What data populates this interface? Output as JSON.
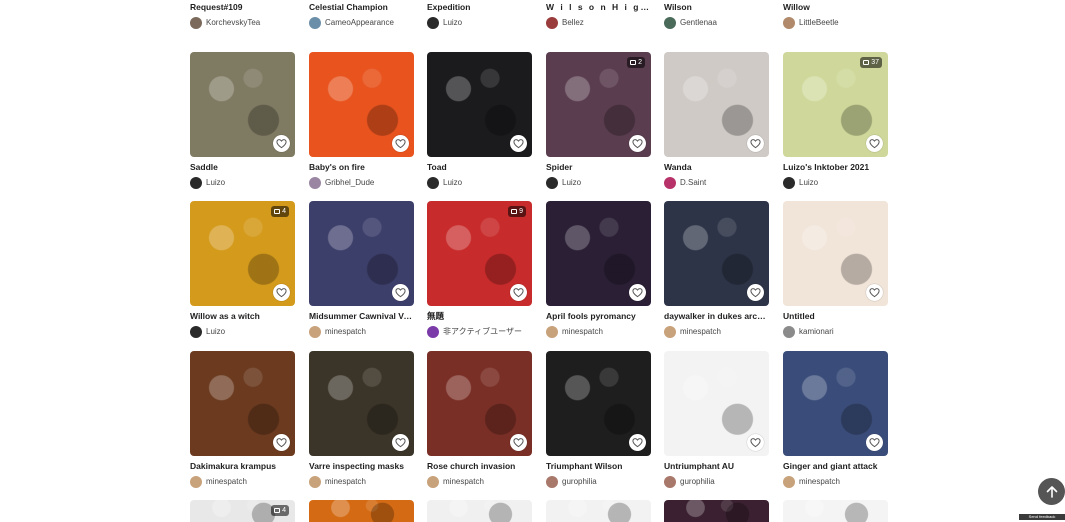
{
  "heart_icon": "heart-icon",
  "rows": [
    {
      "variant": "short",
      "cards": [
        {
          "title": "Request#109",
          "author": "KorchevskyTea",
          "color": "#d9d5cf",
          "avatar": "#7b6a5c"
        },
        {
          "title": "Celestial Champion",
          "author": "CameoAppearance",
          "color": "#2d4a8a",
          "avatar": "#6c8fa9"
        },
        {
          "title": "Expedition",
          "author": "Luizo",
          "color": "#3b3a3a",
          "avatar": "#2a2a2a"
        },
        {
          "title": "W i l s o n H i g g s b u r y",
          "author": "Bellez",
          "color": "#454545",
          "avatar": "#9b3c3c",
          "spaced": true
        },
        {
          "title": "Wilson",
          "author": "Gentlenaa",
          "color": "#e8c8a0",
          "avatar": "#4a6a5a"
        },
        {
          "title": "Willow",
          "author": "LittleBeetle",
          "color": "#b7562b",
          "avatar": "#b08a6a"
        }
      ]
    },
    {
      "cards": [
        {
          "title": "Saddle",
          "author": "Luizo",
          "color": "#7f7a62",
          "avatar": "#2a2a2a"
        },
        {
          "title": "Baby's on fire",
          "author": "Gribhel_Dude",
          "color": "#e8531e",
          "avatar": "#9a86a3"
        },
        {
          "title": "Toad",
          "author": "Luizo",
          "color": "#1b1b1e",
          "avatar": "#2a2a2a"
        },
        {
          "title": "Spider",
          "author": "Luizo",
          "color": "#5a3d4f",
          "avatar": "#2a2a2a",
          "badge": "2"
        },
        {
          "title": "Wanda",
          "author": "D.Saint",
          "color": "#cfcac6",
          "avatar": "#b8326a"
        },
        {
          "title": "Luizo's Inktober 2021",
          "author": "Luizo",
          "color": "#cfd89a",
          "avatar": "#2a2a2a",
          "badge": "37"
        }
      ]
    },
    {
      "cards": [
        {
          "title": "Willow as a witch",
          "author": "Luizo",
          "color": "#d49a1c",
          "avatar": "#2a2a2a",
          "badge": "4"
        },
        {
          "title": "Midsummer Cawnival Velka",
          "author": "minespatch",
          "color": "#3d3f6b",
          "avatar": "#c8a27a"
        },
        {
          "title": "無題",
          "author": "非アクティブユーザー",
          "color": "#c82b2b",
          "avatar": "#7a3aa8",
          "badge": "9"
        },
        {
          "title": "April fools pyromancy",
          "author": "minespatch",
          "color": "#2a1f35",
          "avatar": "#c8a27a"
        },
        {
          "title": "daywalker in dukes archives",
          "author": "minespatch",
          "color": "#2d3447",
          "avatar": "#c8a27a"
        },
        {
          "title": "Untitled",
          "author": "kamionari",
          "color": "#f1e4d8",
          "avatar": "#8b8b8b"
        }
      ]
    },
    {
      "cards": [
        {
          "title": "Dakimakura krampus",
          "author": "minespatch",
          "color": "#6b3a1f",
          "avatar": "#c8a27a"
        },
        {
          "title": "Varre inspecting masks",
          "author": "minespatch",
          "color": "#3b3428",
          "avatar": "#c8a27a"
        },
        {
          "title": "Rose church invasion",
          "author": "minespatch",
          "color": "#7a2f26",
          "avatar": "#c8a27a"
        },
        {
          "title": "Triumphant Wilson",
          "author": "gurophilia",
          "color": "#1e1e1e",
          "avatar": "#a8786a"
        },
        {
          "title": "Untriumphant AU",
          "author": "gurophilia",
          "color": "#f3f3f3",
          "avatar": "#a8786a"
        },
        {
          "title": "Ginger and giant attack",
          "author": "minespatch",
          "color": "#3a4d7a",
          "avatar": "#c8a27a"
        }
      ]
    },
    {
      "variant": "stub",
      "cards": [
        {
          "color": "#e8e8e8",
          "badge": "4"
        },
        {
          "color": "#d46b14"
        },
        {
          "color": "#f0f0f0"
        },
        {
          "color": "#f2f2f2"
        },
        {
          "color": "#3a2030"
        },
        {
          "color": "#f4f4f4"
        }
      ]
    }
  ],
  "footer": {
    "back_to_top_icon": "arrow-up-icon",
    "feedback_label": "Send feedback"
  }
}
